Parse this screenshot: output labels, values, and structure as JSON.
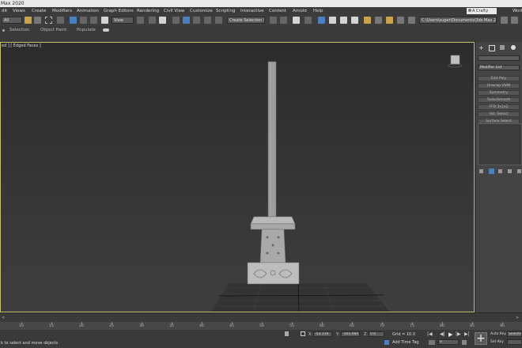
{
  "title": "Max 2020",
  "menu": [
    "dit",
    "Views",
    "Create",
    "Modifiers",
    "Animation",
    "Graph Editors",
    "Rendering",
    "Civil View",
    "Customize",
    "Scripting",
    "Interactive",
    "Content",
    "Arnold",
    "Help"
  ],
  "user": "A Crafty",
  "workspace": "Work",
  "toolbar": {
    "filter": "All",
    "view": "View",
    "selection_set": "Create Selection Se",
    "path": "C:\\Users\\super\\Documents\\3ds Max 2020"
  },
  "ribbon": [
    "Selection",
    "Object Paint",
    "Populate"
  ],
  "viewport": {
    "label": "ed ] [ Edged Faces ]"
  },
  "command_panel": {
    "modifier_list": "Modifier List",
    "buttons": [
      "Edit Poly",
      "Unwrap UVW",
      "Symmetry",
      "TurboSmooth",
      "FFD 2x2x2",
      "Vol. Select",
      "Surface Select"
    ]
  },
  "timeline": {
    "ticks": [
      "10",
      "15",
      "20",
      "25",
      "30",
      "35",
      "40",
      "45",
      "50",
      "55",
      "60",
      "65",
      "70",
      "75",
      "80",
      "85",
      "90"
    ]
  },
  "status": {
    "prompt": "k to select and move objects",
    "x_label": "X:",
    "x_value": "-53.116",
    "y_label": "Y:",
    "y_value": "-105.484",
    "z_label": "Z:",
    "z_value": "0.0",
    "grid": "Grid = 10.0",
    "add_time_tag": "Add Time Tag",
    "auto_key": "Auto Key",
    "set_key": "Set Key",
    "selected": "Selected",
    "frame": "0"
  }
}
